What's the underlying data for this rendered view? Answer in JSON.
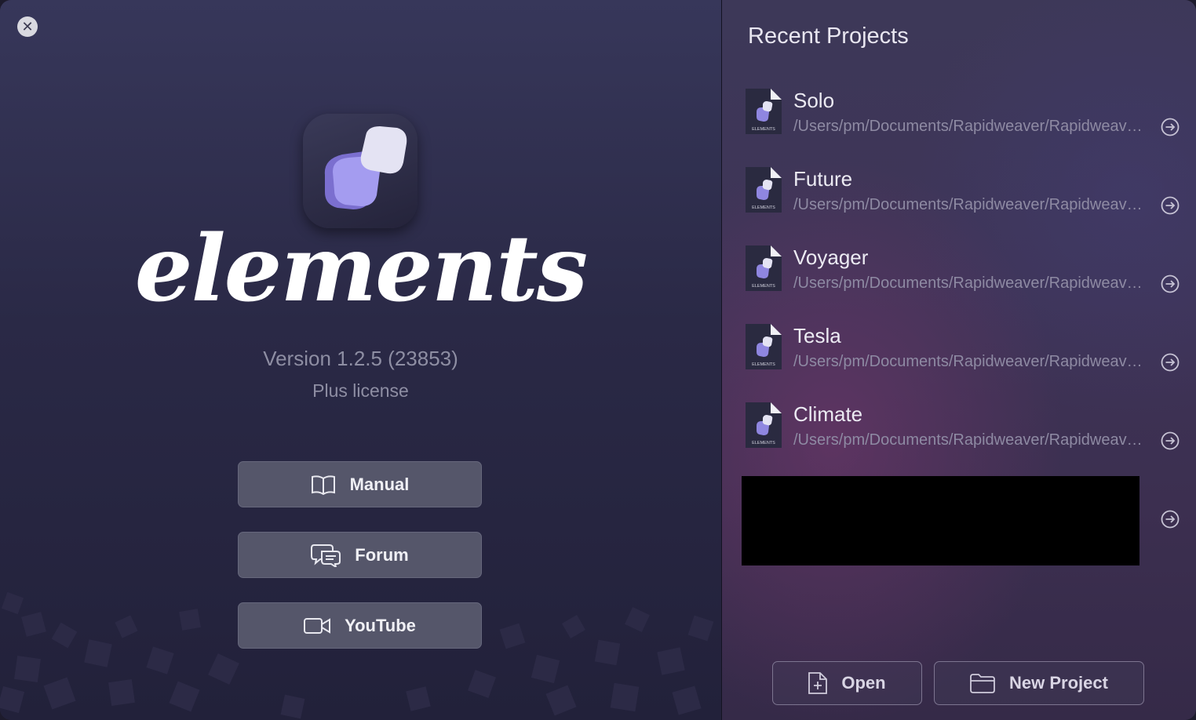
{
  "app": {
    "name": "elements",
    "version": "Version 1.2.5 (23853)",
    "license": "Plus license"
  },
  "links": [
    {
      "label": "Manual",
      "icon": "book-icon"
    },
    {
      "label": "Forum",
      "icon": "chat-bubbles-icon"
    },
    {
      "label": "YouTube",
      "icon": "video-camera-icon"
    }
  ],
  "recent": {
    "title": "Recent Projects",
    "projects": [
      {
        "name": "Solo",
        "path": "/Users/pm/Documents/Rapidweaver/Rapidweaver/Solo.elements"
      },
      {
        "name": "Future",
        "path": "/Users/pm/Documents/Rapidweaver/Rapidweaver/Future.elements"
      },
      {
        "name": "Voyager",
        "path": "/Users/pm/Documents/Rapidweaver/Rapidweaver/Voyager.elements"
      },
      {
        "name": "Tesla",
        "path": "/Users/pm/Documents/Rapidweaver/Rapidweaver/Tesla.elements"
      },
      {
        "name": "Climate",
        "path": "/Users/pm/Documents/Rapidweaver/Rapidweaver/Climate.elements"
      }
    ],
    "doc_icon_label": "ELEMENTS"
  },
  "actions": {
    "open_label": "Open",
    "new_project_label": "New Project"
  },
  "colors": {
    "accent": "#8f86e0",
    "button_bg": "#55566a"
  }
}
